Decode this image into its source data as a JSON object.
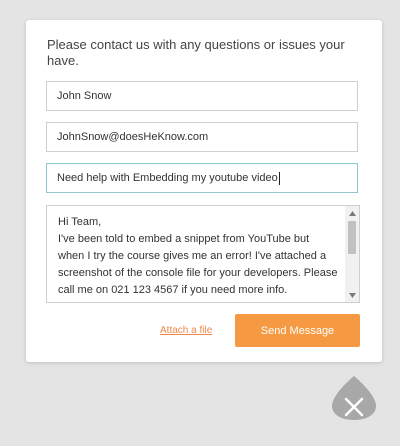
{
  "form": {
    "intro": "Please contact us with any questions or issues your have.",
    "name_value": "John Snow",
    "email_value": "JohnSnow@doesHeKnow.com",
    "subject_value": "Need help with Embedding my youtube video",
    "message_value": "Hi Team,\nI've been told to embed a snippet from YouTube but when I try the course gives me an error! I've attached a screenshot of the console file for your developers. Please call me on 021 123 4567 if you need more info.",
    "attach_label": "Attach a file",
    "send_label": "Send Message"
  },
  "colors": {
    "accent": "#f59a42",
    "link": "#f0884a",
    "focus_border": "#8ec8cf",
    "close_button": "#a8a8a8"
  },
  "icons": {
    "close": "close-icon",
    "scroll_up": "chevron-up-icon",
    "scroll_down": "chevron-down-icon"
  }
}
